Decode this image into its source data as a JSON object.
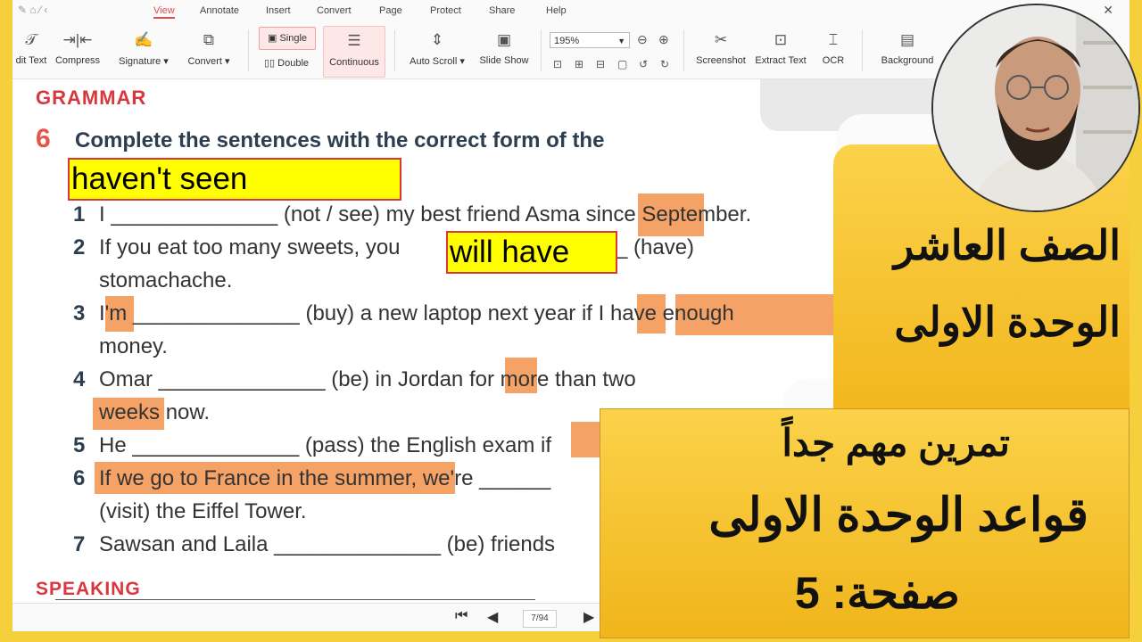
{
  "menubar": {
    "items": [
      "View",
      "Annotate",
      "Insert",
      "Convert",
      "Page",
      "Protect",
      "Share",
      "Help"
    ],
    "active": "View"
  },
  "toolbar": {
    "edit_text": "dit Text",
    "compress": "Compress",
    "signature": "Signature ▾",
    "convert": "Convert ▾",
    "single": "Single",
    "double": "Double",
    "continuous": "Continuous",
    "auto_scroll": "Auto Scroll ▾",
    "slide_show": "Slide Show",
    "zoom": "195%",
    "screenshot": "Screenshot",
    "extract_text": "Extract Text",
    "ocr": "OCR",
    "background": "Background"
  },
  "doc": {
    "grammar_heading": "GRAMMAR",
    "exercise_number": "6",
    "exercise_title": "Complete the sentences with the correct form of the",
    "answer1": "haven't seen",
    "answer2": "will have",
    "sentences": [
      {
        "num": "1",
        "line1": "I ______________ (not / see) my best friend Asma since September."
      },
      {
        "num": "2",
        "line1": "If you eat too many sweets, you",
        "line1b": "_ (have)",
        "line2": "stomachache."
      },
      {
        "num": "3",
        "line1": "I'm ______________ (buy) a new laptop next year if I have enough",
        "line2": "money."
      },
      {
        "num": "4",
        "line1": "Omar ______________ (be) in Jordan for more than two",
        "line2": "weeks now."
      },
      {
        "num": "5",
        "line1": "He ______________ (pass) the English exam if"
      },
      {
        "num": "6",
        "line1": "If we go to France in the summer, we're ______",
        "line2": "(visit) the Eiffel Tower."
      },
      {
        "num": "7",
        "line1": "Sawsan and Laila ______________ (be) friends"
      }
    ],
    "speaking_heading": "SPEAKING"
  },
  "pagenav": {
    "page": "7/94"
  },
  "overlay": {
    "right_line1": "الصف العاشر",
    "right_line2": "الوحدة الاولى",
    "bottom_line1": "تمرين مهم جداً",
    "bottom_line2": "قواعد الوحدة الاولى",
    "bottom_line3": "صفحة: 5"
  },
  "colors": {
    "accent": "#e14b4b",
    "highlight": "#f5a267",
    "banner": "#f6cf3c"
  }
}
